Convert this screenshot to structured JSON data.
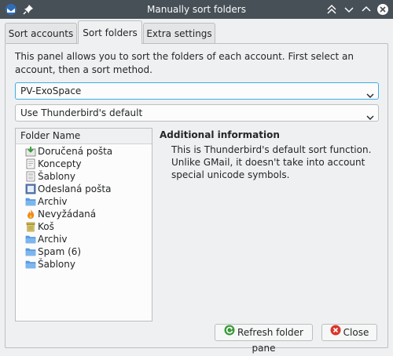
{
  "window": {
    "title": "Manually sort folders"
  },
  "tabs": [
    {
      "label": "Sort accounts"
    },
    {
      "label": "Sort folders"
    },
    {
      "label": "Extra settings"
    }
  ],
  "panel": {
    "intro": "This panel allows you to sort the folders of each account. First select an account, then a sort method.",
    "account_select": {
      "value": "PV-ExoSpace"
    },
    "method_select": {
      "value": "Use Thunderbird's default"
    }
  },
  "tree": {
    "header": "Folder Name",
    "folders": [
      {
        "label": "Doručená pošta",
        "icon": "inbox-icon"
      },
      {
        "label": "Koncepty",
        "icon": "drafts-icon"
      },
      {
        "label": "Šablony",
        "icon": "templates-icon"
      },
      {
        "label": "Odeslaná pošta",
        "icon": "sent-icon"
      },
      {
        "label": "Archiv",
        "icon": "folder-icon"
      },
      {
        "label": "Nevyžádaná",
        "icon": "junk-icon"
      },
      {
        "label": "Koš",
        "icon": "trash-icon"
      },
      {
        "label": "Archiv",
        "icon": "folder-icon"
      },
      {
        "label": "Spam (6)",
        "icon": "folder-icon"
      },
      {
        "label": "Šablony",
        "icon": "folder-icon"
      }
    ]
  },
  "info": {
    "title": "Additional information",
    "body": "This is Thunderbird's default sort function. Unlike GMail, it doesn't take into account special unicode symbols."
  },
  "buttons": {
    "refresh": "Refresh folder pane",
    "close": "Close"
  },
  "colors": {
    "titlebar": "#475057",
    "accent": "#3daee9",
    "folder": "#5aa0e6"
  }
}
